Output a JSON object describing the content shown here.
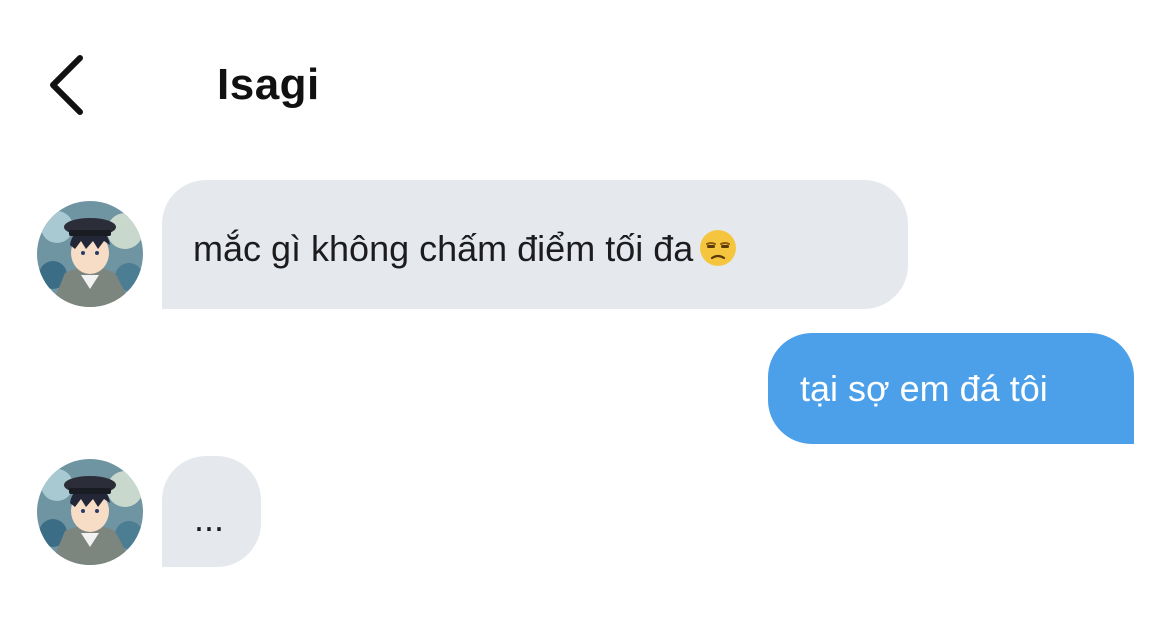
{
  "header": {
    "title": "Isagi"
  },
  "messages": [
    {
      "direction": "incoming",
      "text": "mắc gì không chấm điểm tối đa",
      "emoji": "unamused-face-emoji"
    },
    {
      "direction": "outgoing",
      "text": "tại sợ em đá tôi"
    },
    {
      "direction": "incoming",
      "text": "..."
    }
  ],
  "colors": {
    "incoming_bubble": "#e5e8ed",
    "outgoing_bubble": "#4c9fe9",
    "incoming_text": "#1c1c1e",
    "outgoing_text": "#ffffff",
    "title_text": "#111111"
  }
}
